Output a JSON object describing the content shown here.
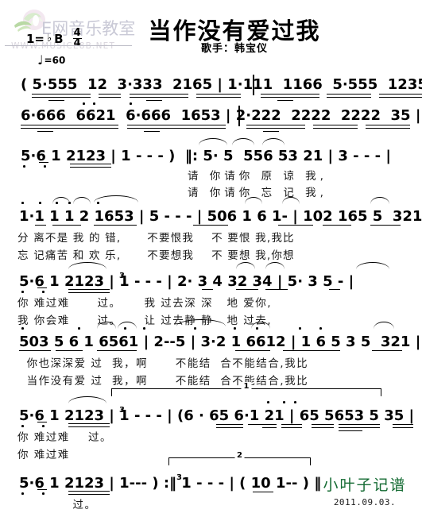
{
  "watermark": {
    "site_text": "E网音乐教室",
    "url_text": "WWW.MUSICE8B.NET",
    "logo_icon": "lily-flower-icon",
    "color": "#c9c9d6"
  },
  "header": {
    "title": "当作没有爱过我",
    "singer": "歌手：韩宝仪",
    "key_label": "1=",
    "key_accidental": "♭",
    "key_note": "B",
    "meter_numerator": "4",
    "meter_denominator": "4",
    "tempo_note": "♩",
    "tempo_text": "=60"
  },
  "score": {
    "rows": [
      {
        "id": "row-1",
        "notes": "( 5·555  12  3·333  2165 | 1·111  1166  5·555  1235 |",
        "lyrics_a": "",
        "lyrics_b": ""
      },
      {
        "id": "row-2",
        "notes": "6·666  6621  6·666  1653 | 2·222  2222  2222  35 |",
        "lyrics_a": "",
        "lyrics_b": ""
      },
      {
        "id": "row-3",
        "notes": "5·6 1 2123 | 1 - - - )  ‖: 5· 5  556 53 21 | 3 - - - |",
        "lyrics_a": "请 你请你 原 谅 我,",
        "lyrics_b": "请 你请你 忘 记 我,"
      },
      {
        "id": "row-4",
        "notes": "1·1 1 1 2 1653 | 5 - - - | 506 1 6 1- | 102 165 5  321 |",
        "lyrics_a": "分 离不是 我 的 错,      不要恨我    不 要恨 我,我比",
        "lyrics_b": "忘 记痛苦 和 欢 乐,      不要想我    不 要想 我,你想"
      },
      {
        "id": "row-5",
        "notes": "5·6 1 2123 | 1 - - - | 2· 3 4 32 34 | 5· 3 5 - |",
        "notes_triplet": "3",
        "lyrics_a": "你 难过难      过。     我 过去深 深   地 爱你,",
        "lyrics_b": "我 你会难      过。     让 过去静 静   地 过去,"
      },
      {
        "id": "row-6",
        "notes": "503 5 6 1 6561 | 2--5 | 3·2 1 6612 | 1 6 5 3 5  321 |",
        "lyrics_a": "  你也深深爱 过  我，啊      不能结  合不能结合,我比",
        "lyrics_b": "  当作没有爱 过  我，啊      不能结  合不能结合,我比"
      },
      {
        "id": "row-7",
        "notes": "5·6 1 2123 | 1 - - - | (6 · 65 6·1 21 | 65 5653 5 35 |",
        "notes_triplet": "3",
        "ending_label": "1",
        "lyrics_a": "你 难过难    过。",
        "lyrics_b": "你 难过难"
      },
      {
        "id": "row-8",
        "notes": "5·6 1 2123 | 1--- ) :‖ 1 - - - | ( 10 1-- ) ‖",
        "notes_triplet": "3",
        "ending_label": "2",
        "lyrics_a": "            过。",
        "lyrics_b": ""
      }
    ]
  },
  "credit": {
    "transcriber": "小叶子记谱",
    "date": "2011.09.03.",
    "color": "#156b33"
  }
}
